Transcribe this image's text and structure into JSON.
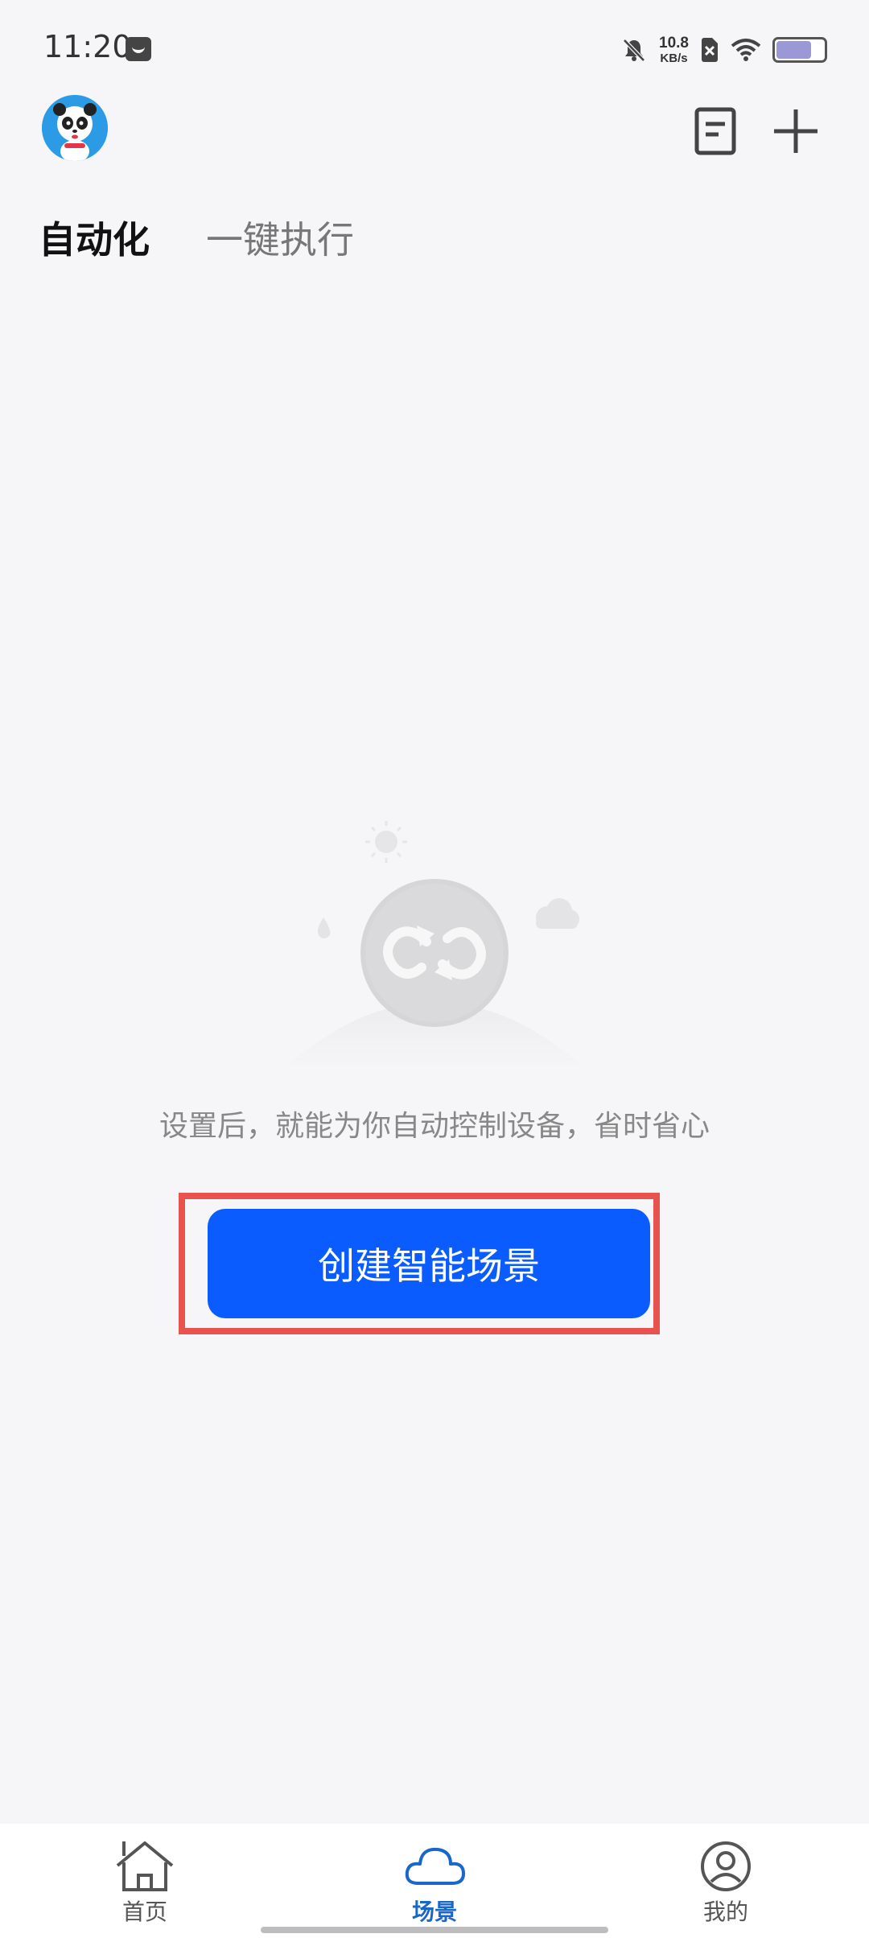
{
  "status_bar": {
    "time": "11:20",
    "net_speed_value": "10.8",
    "net_speed_unit": "KB/s",
    "battery_level": 0.7
  },
  "header": {
    "avatar_icon": "panda-avatar-icon",
    "doc_icon": "document-icon",
    "add_icon": "plus-icon"
  },
  "tabs": [
    {
      "label": "自动化",
      "active": true
    },
    {
      "label": "一键执行",
      "active": false
    }
  ],
  "empty_state": {
    "illustration_icon": "loop-sync-icon",
    "message": "设置后，就能为你自动控制设备，省时省心",
    "button_label": "创建智能场景",
    "highlight_color": "#e8534f",
    "button_color": "#0a5cff"
  },
  "bottom_nav": [
    {
      "label": "首页",
      "icon": "home-icon",
      "active": false
    },
    {
      "label": "场景",
      "icon": "cloud-icon",
      "active": true
    },
    {
      "label": "我的",
      "icon": "user-icon",
      "active": false
    }
  ],
  "colors": {
    "background": "#f6f6f8",
    "active_nav": "#1967c8"
  }
}
